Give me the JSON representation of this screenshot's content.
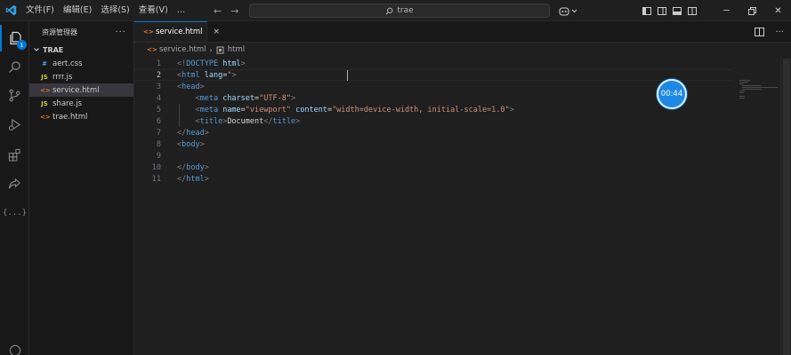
{
  "menu": [
    "文件(F)",
    "编辑(E)",
    "选择(S)",
    "查看(V)",
    "…"
  ],
  "search": {
    "label": "trae"
  },
  "activity": {
    "explorer_badge": "1",
    "extensions_label": "{...}"
  },
  "sidebar": {
    "title": "资源管理器",
    "more": "···",
    "root": "TRAE",
    "files": [
      {
        "icon": "#",
        "name": "aert.css",
        "type": "css"
      },
      {
        "icon": "JS",
        "name": "rrrr.js",
        "type": "js"
      },
      {
        "icon": "<>",
        "name": "service.html",
        "type": "html",
        "active": true
      },
      {
        "icon": "JS",
        "name": "share.js",
        "type": "js"
      },
      {
        "icon": "<>",
        "name": "trae.html",
        "type": "html"
      }
    ]
  },
  "tab": {
    "label": "service.html",
    "close": "×"
  },
  "breadcrumb": {
    "file": "service.html",
    "element": "html"
  },
  "code": {
    "line_numbers": [
      "1",
      "2",
      "3",
      "4",
      "5",
      "6",
      "7",
      "8",
      "9",
      "10",
      "11"
    ],
    "current_line": 2,
    "lines": [
      [
        {
          "t": "<!",
          "c": "t-br"
        },
        {
          "t": "DOCTYPE",
          "c": "t-doc"
        },
        {
          "t": " html",
          "c": "t-attr"
        },
        {
          "t": ">",
          "c": "t-br"
        }
      ],
      [
        {
          "t": "<",
          "c": "t-br"
        },
        {
          "t": "html",
          "c": "t-tag"
        },
        {
          "t": " lang",
          "c": "t-attr"
        },
        {
          "t": "=",
          "c": "t-text"
        },
        {
          "t": "\"",
          "c": "t-str"
        },
        {
          "t": ">",
          "c": "t-br"
        }
      ],
      [
        {
          "t": "<",
          "c": "t-br"
        },
        {
          "t": "head",
          "c": "t-tag"
        },
        {
          "t": ">",
          "c": "t-br"
        }
      ],
      [
        {
          "t": "    <",
          "c": "t-br"
        },
        {
          "t": "meta",
          "c": "t-tag"
        },
        {
          "t": " charset",
          "c": "t-attr"
        },
        {
          "t": "=",
          "c": "t-text"
        },
        {
          "t": "\"UTF-8\"",
          "c": "t-str"
        },
        {
          "t": ">",
          "c": "t-br"
        }
      ],
      [
        {
          "t": "    <",
          "c": "t-br"
        },
        {
          "t": "meta",
          "c": "t-tag"
        },
        {
          "t": " name",
          "c": "t-attr"
        },
        {
          "t": "=",
          "c": "t-text"
        },
        {
          "t": "\"viewport\"",
          "c": "t-str"
        },
        {
          "t": " content",
          "c": "t-attr"
        },
        {
          "t": "=",
          "c": "t-text"
        },
        {
          "t": "\"width=device-width, initial-scale=1.0\"",
          "c": "t-str"
        },
        {
          "t": ">",
          "c": "t-br"
        }
      ],
      [
        {
          "t": "    <",
          "c": "t-br"
        },
        {
          "t": "title",
          "c": "t-tag"
        },
        {
          "t": ">",
          "c": "t-br"
        },
        {
          "t": "Document",
          "c": "t-text"
        },
        {
          "t": "</",
          "c": "t-br"
        },
        {
          "t": "title",
          "c": "t-tag"
        },
        {
          "t": ">",
          "c": "t-br"
        }
      ],
      [
        {
          "t": "</",
          "c": "t-br"
        },
        {
          "t": "head",
          "c": "t-tag"
        },
        {
          "t": ">",
          "c": "t-br"
        }
      ],
      [
        {
          "t": "<",
          "c": "t-br"
        },
        {
          "t": "body",
          "c": "t-tag"
        },
        {
          "t": ">",
          "c": "t-br"
        }
      ],
      [],
      [
        {
          "t": "</",
          "c": "t-br"
        },
        {
          "t": "body",
          "c": "t-tag"
        },
        {
          "t": ">",
          "c": "t-br"
        }
      ],
      [
        {
          "t": "</",
          "c": "t-br"
        },
        {
          "t": "html",
          "c": "t-tag"
        },
        {
          "t": ">",
          "c": "t-br"
        }
      ]
    ]
  },
  "timer": {
    "label": "00:44"
  },
  "colors": {
    "accent": "#0078d4",
    "timer": "#1e88e5"
  }
}
